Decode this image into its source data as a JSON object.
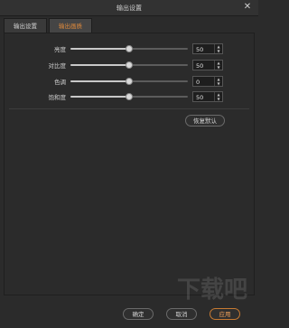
{
  "window": {
    "title": "输出设置"
  },
  "tabs": [
    {
      "label": "输出设置",
      "active": false
    },
    {
      "label": "输出画质",
      "active": true
    }
  ],
  "sliders": [
    {
      "label": "亮度",
      "value": "50",
      "level": 0.5
    },
    {
      "label": "对比度",
      "value": "50",
      "level": 0.5
    },
    {
      "label": "色调",
      "value": "0",
      "level": 0.5
    },
    {
      "label": "饱和度",
      "value": "50",
      "level": 0.5
    }
  ],
  "reset_label": "恢复默认",
  "footer": {
    "ok_label": "确定",
    "cancel_label": "取消",
    "apply_label": "应用"
  },
  "watermark": "下载吧",
  "colors": {
    "accent": "#e08a3c",
    "background": "#2b2b2b"
  }
}
